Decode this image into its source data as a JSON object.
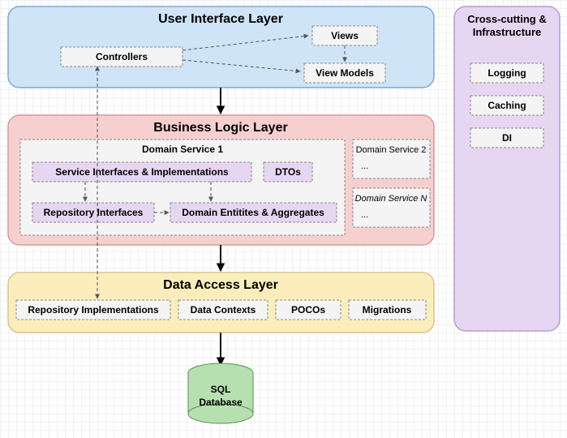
{
  "ui_layer": {
    "title": "User Interface Layer",
    "controllers": "Controllers",
    "views": "Views",
    "view_models": "View Models"
  },
  "bll": {
    "title": "Business Logic Layer",
    "ds1": {
      "title": "Domain Service 1",
      "services": "Service Interfaces & Implementations",
      "dtos": "DTOs",
      "repo_if": "Repository Interfaces",
      "entities": "Domain Entitites & Aggregates"
    },
    "ds2": {
      "title": "Domain Service 2",
      "dots": "..."
    },
    "dsN": {
      "title": "Domain Service N",
      "dots": "..."
    }
  },
  "dal": {
    "title": "Data Access Layer",
    "repo_impl": "Repository Implementations",
    "contexts": "Data Contexts",
    "pocos": "POCOs",
    "migrations": "Migrations"
  },
  "db": {
    "label1": "SQL",
    "label2": "Database"
  },
  "cross": {
    "title1": "Cross-cutting &",
    "title2": "Infrastructure",
    "logging": "Logging",
    "caching": "Caching",
    "di": "DI"
  }
}
